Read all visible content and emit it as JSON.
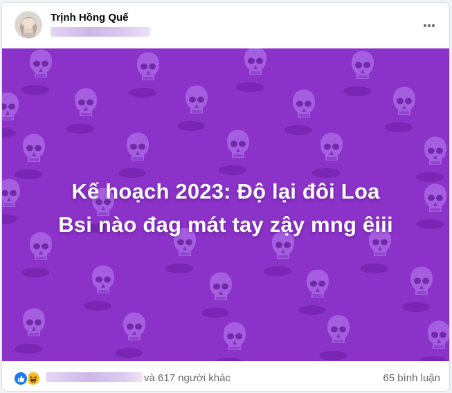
{
  "post": {
    "author_name": "Trịnh Hồng Quế",
    "image_caption_line1": "Kế hoạch 2023: Độ lại đôi Loa",
    "image_caption_line2": "Bsi nào đag mát tay zậy mng êiii",
    "reaction_summary": "và 617 người khác",
    "comment_count": "65 bình luận"
  },
  "icons": {
    "more": "more-horizontal-icon",
    "like": "like-reaction-icon",
    "haha": "haha-reaction-icon",
    "skull": "skull-pattern-icon"
  },
  "colors": {
    "image_background": "#8b32c8",
    "skull": "#a55ee0",
    "like": "#1877f2",
    "haha": "#f7b928",
    "text_secondary": "#65676b"
  }
}
